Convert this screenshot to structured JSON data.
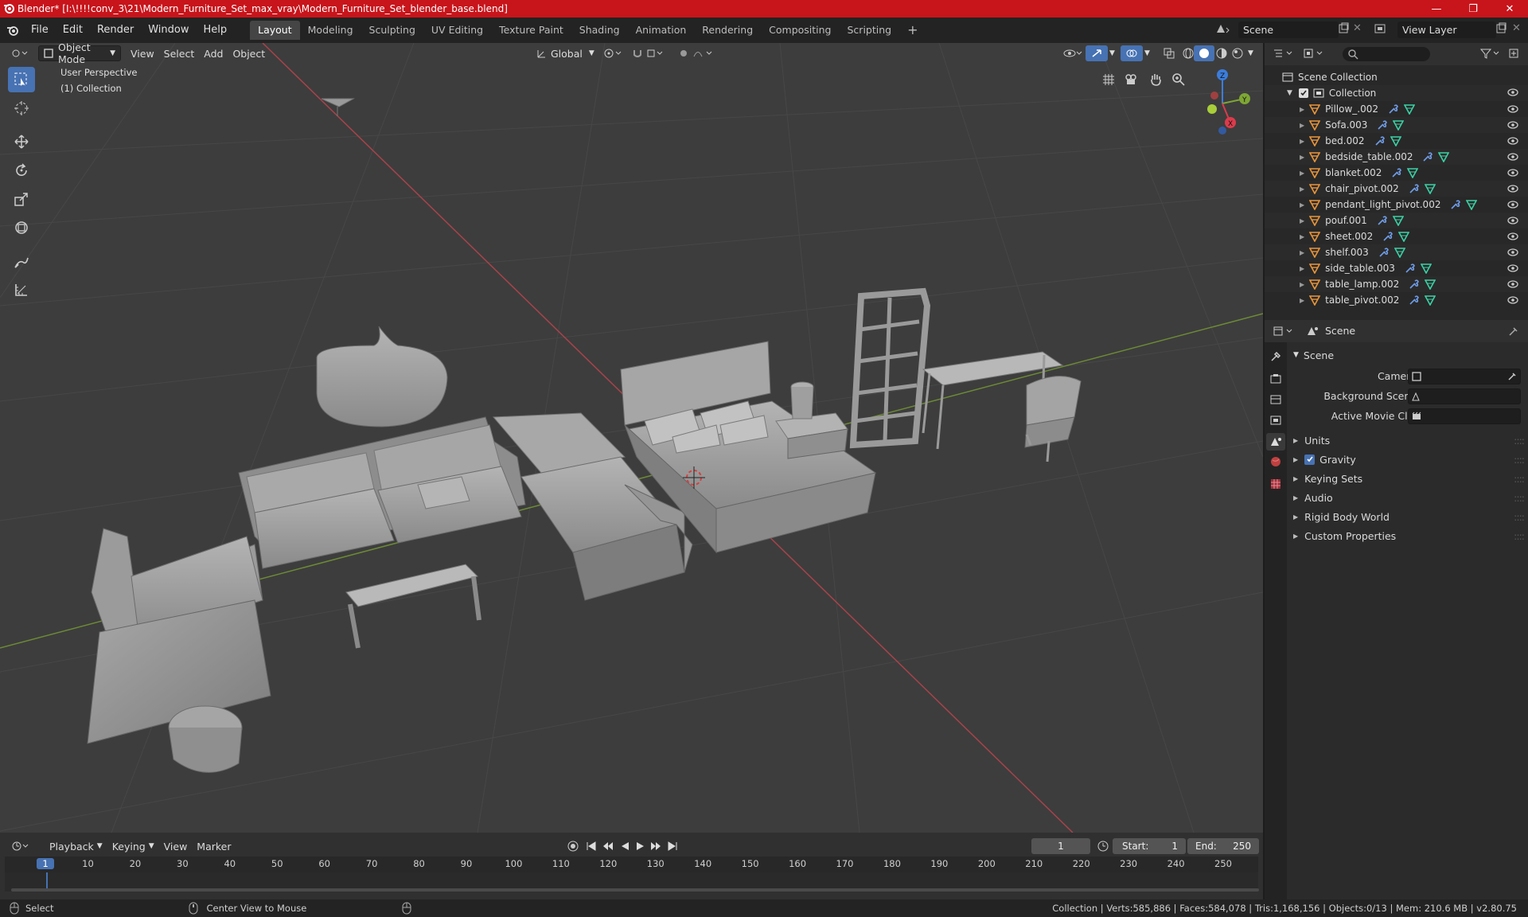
{
  "window": {
    "title": "Blender* [I:\\!!!!conv_3\\21\\Modern_Furniture_Set_max_vray\\Modern_Furniture_Set_blender_base.blend]"
  },
  "menu": {
    "items": [
      "File",
      "Edit",
      "Render",
      "Window",
      "Help"
    ]
  },
  "workspaces": {
    "tabs": [
      "Layout",
      "Modeling",
      "Sculpting",
      "UV Editing",
      "Texture Paint",
      "Shading",
      "Animation",
      "Rendering",
      "Compositing",
      "Scripting"
    ],
    "active": "Layout"
  },
  "scene_selector": {
    "value": "Scene"
  },
  "viewlayer_selector": {
    "value": "View Layer"
  },
  "viewport_header": {
    "mode": "Object Mode",
    "menus": [
      "View",
      "Select",
      "Add",
      "Object"
    ],
    "orientation": "Global"
  },
  "viewport": {
    "perspective_label": "User Perspective",
    "collection_label": "(1) Collection",
    "gizmo_axes": [
      "X",
      "Y",
      "Z"
    ]
  },
  "outliner": {
    "root": "Scene Collection",
    "collection": "Collection",
    "objects": [
      "Pillow_.002",
      "Sofa.003",
      "bed.002",
      "bedside_table.002",
      "blanket.002",
      "chair_pivot.002",
      "pendant_light_pivot.002",
      "pouf.001",
      "sheet.002",
      "shelf.003",
      "side_table.003",
      "table_lamp.002",
      "table_pivot.002"
    ]
  },
  "properties": {
    "context": "Scene",
    "panel_title": "Scene",
    "fields": {
      "camera": "Camera",
      "background_scene": "Background Scene",
      "active_movie_clip": "Active Movie Clip"
    },
    "subpanels": [
      "Units",
      "Gravity",
      "Keying Sets",
      "Audio",
      "Rigid Body World",
      "Custom Properties"
    ],
    "gravity_checked": true
  },
  "timeline": {
    "menus": [
      "Playback",
      "Keying",
      "View",
      "Marker"
    ],
    "current_frame": "1",
    "start_label": "Start:",
    "start": "1",
    "end_label": "End:",
    "end": "250",
    "ruler_marks": [
      "1",
      "10",
      "20",
      "30",
      "40",
      "50",
      "60",
      "70",
      "80",
      "90",
      "100",
      "110",
      "120",
      "130",
      "140",
      "150",
      "160",
      "170",
      "180",
      "190",
      "200",
      "210",
      "220",
      "230",
      "240",
      "250"
    ]
  },
  "statusbar": {
    "left_action": "Select",
    "middle_action": "Center View to Mouse",
    "stats": "Collection | Verts:585,886 | Faces:584,078 | Tris:1,168,156 | Objects:0/13 | Mem: 210.6 MB | v2.80.75"
  },
  "colors": {
    "titlebar": "#c8141b",
    "accent_blue": "#4772b3",
    "axis_x": "#db3b4c",
    "axis_y": "#7ea634",
    "axis_z": "#3b7ddb"
  }
}
